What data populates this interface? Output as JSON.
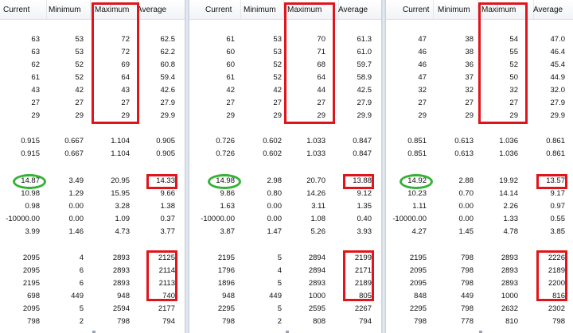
{
  "columns": [
    "Current",
    "Minimum",
    "Maximum",
    "Average"
  ],
  "panels": [
    {
      "rows": [
        [
          "63",
          "53",
          "72",
          "62.5"
        ],
        [
          "63",
          "53",
          "72",
          "62.2"
        ],
        [
          "62",
          "52",
          "69",
          "60.8"
        ],
        [
          "61",
          "52",
          "64",
          "59.4"
        ],
        [
          "43",
          "42",
          "43",
          "42.6"
        ],
        [
          "27",
          "27",
          "27",
          "27.9"
        ],
        [
          "29",
          "29",
          "29",
          "29.9"
        ],
        [
          "0.915",
          "0.667",
          "1.104",
          "0.905"
        ],
        [
          "0.915",
          "0.667",
          "1.104",
          "0.905"
        ],
        [
          "14.87",
          "3.49",
          "20.95",
          "14.33"
        ],
        [
          "10.98",
          "1.29",
          "15.95",
          "9.66"
        ],
        [
          "0.98",
          "0.00",
          "3.28",
          "1.38"
        ],
        [
          "-10000.00",
          "0.00",
          "1.09",
          "0.37"
        ],
        [
          "3.99",
          "1.46",
          "4.73",
          "3.77"
        ],
        [
          "2095",
          "4",
          "2893",
          "2125"
        ],
        [
          "2095",
          "6",
          "2893",
          "2114"
        ],
        [
          "2195",
          "6",
          "2893",
          "2113"
        ],
        [
          "698",
          "449",
          "948",
          "740"
        ],
        [
          "2095",
          "5",
          "2594",
          "2177"
        ],
        [
          "798",
          "2",
          "798",
          "794"
        ]
      ]
    },
    {
      "rows": [
        [
          "61",
          "53",
          "70",
          "61.3"
        ],
        [
          "60",
          "53",
          "71",
          "61.0"
        ],
        [
          "60",
          "52",
          "68",
          "59.7"
        ],
        [
          "61",
          "52",
          "64",
          "58.9"
        ],
        [
          "42",
          "42",
          "44",
          "42.5"
        ],
        [
          "27",
          "27",
          "27",
          "27.9"
        ],
        [
          "29",
          "29",
          "29",
          "29.9"
        ],
        [
          "0.726",
          "0.602",
          "1.033",
          "0.847"
        ],
        [
          "0.726",
          "0.602",
          "1.033",
          "0.847"
        ],
        [
          "14.98",
          "2.98",
          "20.70",
          "13.88"
        ],
        [
          "9.86",
          "0.80",
          "14.26",
          "9.12"
        ],
        [
          "1.63",
          "0.00",
          "3.11",
          "1.35"
        ],
        [
          "-10000.00",
          "0.00",
          "1.08",
          "0.40"
        ],
        [
          "3.87",
          "1.47",
          "5.26",
          "3.93"
        ],
        [
          "2195",
          "5",
          "2894",
          "2199"
        ],
        [
          "1796",
          "4",
          "2894",
          "2171"
        ],
        [
          "1896",
          "5",
          "2893",
          "2189"
        ],
        [
          "948",
          "449",
          "1000",
          "805"
        ],
        [
          "2295",
          "5",
          "2595",
          "2267"
        ],
        [
          "798",
          "2",
          "808",
          "794"
        ]
      ]
    },
    {
      "rows": [
        [
          "47",
          "38",
          "54",
          "47.0"
        ],
        [
          "46",
          "38",
          "55",
          "46.4"
        ],
        [
          "46",
          "36",
          "52",
          "45.4"
        ],
        [
          "47",
          "37",
          "50",
          "44.9"
        ],
        [
          "32",
          "32",
          "32",
          "32.0"
        ],
        [
          "27",
          "27",
          "27",
          "27.9"
        ],
        [
          "29",
          "29",
          "29",
          "29.9"
        ],
        [
          "0.851",
          "0.613",
          "1.036",
          "0.861"
        ],
        [
          "0.851",
          "0.613",
          "1.036",
          "0.861"
        ],
        [
          "14.92",
          "2.88",
          "19.92",
          "13.57"
        ],
        [
          "10.23",
          "0.70",
          "14.14",
          "9.17"
        ],
        [
          "1.11",
          "0.00",
          "2.26",
          "0.97"
        ],
        [
          "-10000.00",
          "0.00",
          "1.33",
          "0.55"
        ],
        [
          "4.27",
          "1.45",
          "4.78",
          "3.85"
        ],
        [
          "2195",
          "798",
          "2893",
          "2226"
        ],
        [
          "2095",
          "798",
          "2893",
          "2189"
        ],
        [
          "2095",
          "798",
          "2893",
          "2200"
        ],
        [
          "848",
          "449",
          "1000",
          "816"
        ],
        [
          "2295",
          "798",
          "2632",
          "2302"
        ],
        [
          "798",
          "778",
          "810",
          "798"
        ]
      ]
    }
  ],
  "annotation_colors": {
    "red": "#e0151b",
    "green": "#34b233"
  }
}
